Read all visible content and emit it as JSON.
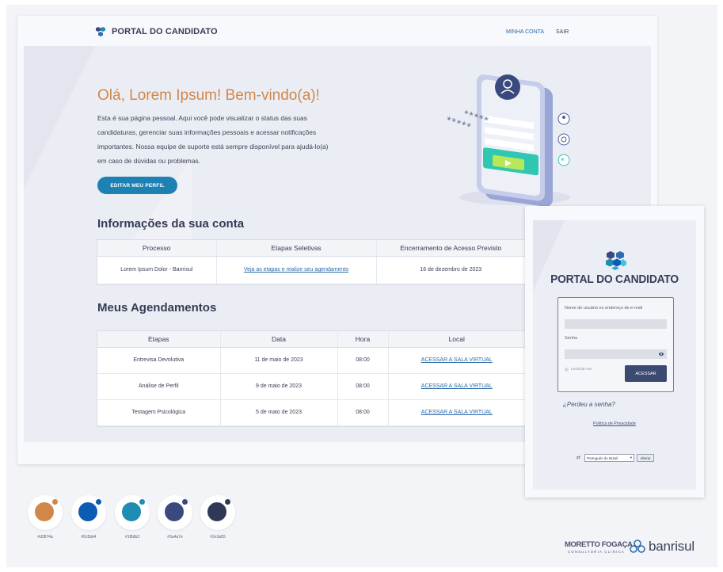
{
  "portal": {
    "logo_text": "PORTAL DO CANDIDATO",
    "nav": {
      "account": "MINHA CONTA",
      "logout": "SAIR"
    },
    "welcome_title": "Olá, Lorem Ipsum! Bem-vindo(a)!",
    "welcome_text": "Esta é sua página pessoal. Aqui você pode visualizar o status das suas candidaturas, gerenciar suas informações pessoais e acessar notificações importantes. Nossa equipe de suporte está sempre disponível para ajudá-lo(a) em caso de dúvidas ou problemas.",
    "edit_button": "EDITAR MEU PERFIL",
    "illustration_password": "*****",
    "account_section_title": "Informações da sua conta",
    "account_table": {
      "headers": [
        "Processo",
        "Etapas Seletivas",
        "Encerramento de Acesso Previsto"
      ],
      "row": [
        "Lorem Ipsum Dolor - Banrisul",
        "Veja as etapas e realize seu agendamento",
        "16 de dezembro de 2023"
      ]
    },
    "schedule_section_title": "Meus Agendamentos",
    "schedule_table": {
      "headers": [
        "Etapas",
        "Data",
        "Hora",
        "Local"
      ],
      "rows": [
        [
          "Entrevisa Devolutiva",
          "11 de maio de 2023",
          "08:00",
          "ACESSAR A SALA VIRTUAL"
        ],
        [
          "Análise de Perfil",
          "9 de maio de 2023",
          "08:00",
          "ACESSAR A SALA VIRTUAL"
        ],
        [
          "Testagem Psicológica",
          "5 de maio de 2023",
          "08:00",
          "ACESSAR A SALA VIRTUAL"
        ]
      ]
    }
  },
  "login": {
    "title": "PORTAL DO CANDIDATO",
    "username_label": "Nome de usuário ou endereço de e-mail",
    "password_label": "Senha",
    "remember_label": "Lembrar-me",
    "submit": "ACESSAR",
    "forgot": "¿Perdeu a senha?",
    "privacy": "Política de Privacidade",
    "language_value": "Português do Brasil",
    "language_button": "Alterar"
  },
  "palette": [
    {
      "hex": "#d2874a",
      "label": "#d2874a"
    },
    {
      "hex": "#0c5bb4",
      "label": "#0c5bb4"
    },
    {
      "hex": "#1f8db3",
      "label": "#1f8db3"
    },
    {
      "hex": "#3a4a7e",
      "label": "#3a4a7e"
    },
    {
      "hex": "#2e3a55",
      "label": "#2e3a55"
    }
  ],
  "brands": {
    "moretto_fogaca": "MORETTO FOGAÇA",
    "moretto_fogaca_sub": "CONSULTORIA CLÍNICA",
    "banrisul": "banrisul"
  },
  "colors": {
    "accent_orange": "#d2874a",
    "primary_blue": "#1d81b3",
    "dark_navy": "#353c57",
    "link_blue": "#2a6aa6"
  }
}
